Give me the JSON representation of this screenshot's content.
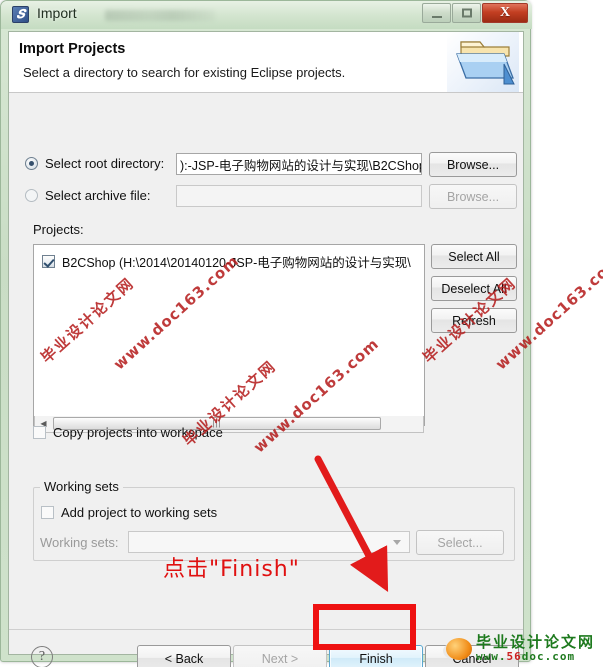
{
  "window": {
    "title": "Import",
    "icon": "eclipse-icon",
    "controls": {
      "minimize": "minimize-button",
      "maximize": "maximize-button",
      "close_label": "X"
    }
  },
  "header": {
    "title": "Import Projects",
    "subtitle": "Select a directory to search for existing Eclipse projects.",
    "icon": "folder-import-icon"
  },
  "source": {
    "root_directory": {
      "label": "Select root directory:",
      "selected": true,
      "value": "):-JSP-电子购物网站的设计与实现\\B2CShop",
      "browse_label": "Browse..."
    },
    "archive_file": {
      "label": "Select archive file:",
      "selected": false,
      "value": "",
      "browse_label": "Browse...",
      "disabled": true
    }
  },
  "projects": {
    "label": "Projects:",
    "items": [
      {
        "checked": true,
        "text": "B2CShop (H:\\2014\\20140120-JSP-电子购物网站的设计与实现\\"
      }
    ],
    "buttons": [
      {
        "label": "Select All",
        "name": "select-all-button"
      },
      {
        "label": "Deselect All",
        "name": "deselect-all-button"
      },
      {
        "label": "Refresh",
        "name": "refresh-button"
      }
    ],
    "scrollbar": {
      "left_arrow": "◀",
      "thumb_grip": "|||"
    }
  },
  "options": {
    "copy_projects": {
      "label": "Copy projects into workspace",
      "checked": false
    }
  },
  "working_sets": {
    "group_title": "Working sets",
    "add_project": {
      "label": "Add project to working sets",
      "checked": false
    },
    "combo_label": "Working sets:",
    "combo_value": "",
    "select_label": "Select...",
    "disabled": true
  },
  "footer": {
    "help": "?",
    "back_label": "< Back",
    "next_label": "Next >",
    "finish_label": "Finish",
    "cancel_label": "Cancel",
    "next_disabled": true
  },
  "annotations": {
    "callout_text": "点击\"Finish\"",
    "callout_color": "#e01010",
    "highlight_color": "#ee1111",
    "arrow_color": "#e21b1b"
  },
  "watermarks": {
    "color": "#b41a1a",
    "items": [
      {
        "cn": "毕业设计论文网",
        "en": "www.doc163.com"
      },
      {
        "cn": "毕业设计论文网",
        "en": "www.doc163.com"
      },
      {
        "cn": "毕业设计论文网",
        "en": "www.doc163.com"
      }
    ],
    "logo": {
      "cn": "毕业设计论文网",
      "en_prefix": "www.",
      "en_highlight": "56",
      "en_suffix": "doc.com"
    }
  }
}
